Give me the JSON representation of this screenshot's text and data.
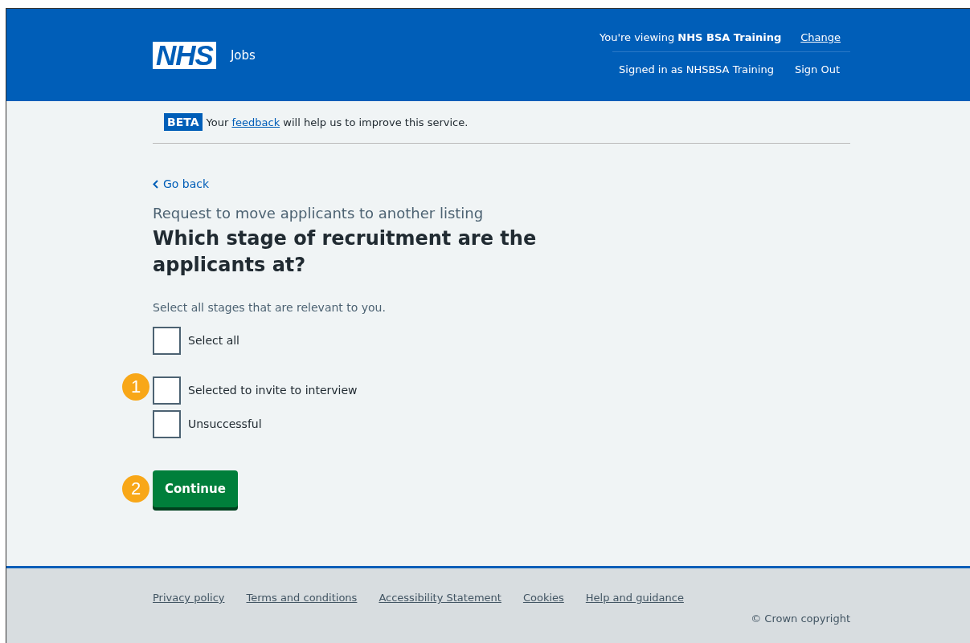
{
  "header": {
    "logo": "NHS",
    "service": "Jobs",
    "viewing_prefix": "You're viewing",
    "viewing_org": "NHS BSA Training",
    "change_link": "Change",
    "signed_in": "Signed in as NHSBSA Training",
    "sign_out": "Sign Out"
  },
  "beta": {
    "tag": "BETA",
    "before": "Your",
    "link": "feedback",
    "after": "will help us to improve this service."
  },
  "back_link": "Go back",
  "caption": "Request to move applicants to another listing",
  "heading": "Which stage of recruitment are the applicants at?",
  "hint": "Select all stages that are relevant to you.",
  "select_all": {
    "label": "Select all",
    "checked": false
  },
  "checkboxes": [
    {
      "label": "Selected to invite to interview",
      "checked": false,
      "callout": "1"
    },
    {
      "label": "Unsuccessful",
      "checked": false
    }
  ],
  "button": {
    "label": "Continue",
    "callout": "2"
  },
  "footer": {
    "links": [
      "Privacy policy",
      "Terms and conditions",
      "Accessibility Statement",
      "Cookies",
      "Help and guidance"
    ],
    "copyright": "© Crown copyright"
  }
}
